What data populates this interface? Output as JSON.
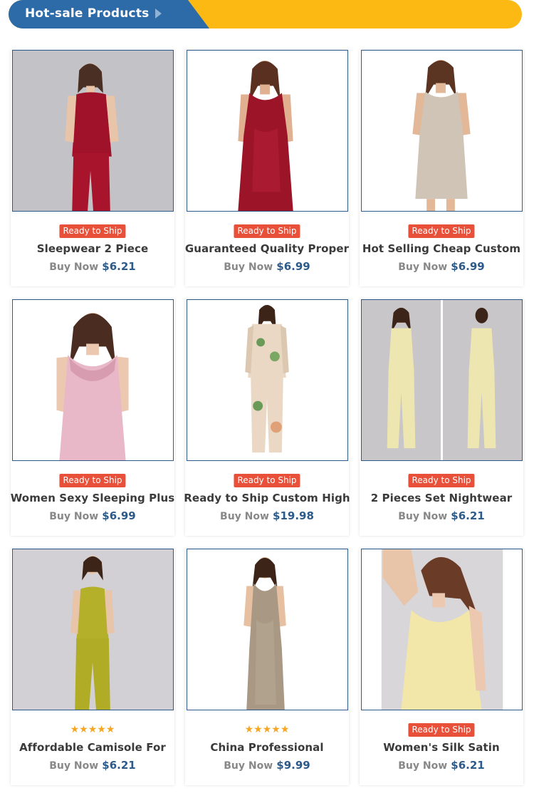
{
  "header": {
    "title": "Hot-sale Products"
  },
  "colors": {
    "banner_blue": "#2c6aa8",
    "banner_yellow": "#fdb913",
    "badge": "#e8503a",
    "price": "#2c5a8a"
  },
  "products": [
    {
      "title": "Sleepwear 2 Piece",
      "badge": "Ready to Ship",
      "buy_label": "Buy Now",
      "price": "$6.21",
      "image": "red-satin-pajama-set"
    },
    {
      "title": "Guaranteed Quality Proper",
      "badge": "Ready to Ship",
      "buy_label": "Buy Now",
      "price": "$6.99",
      "image": "red-satin-slip-dress"
    },
    {
      "title": "Hot Selling Cheap Custom",
      "badge": "Ready to Ship",
      "buy_label": "Buy Now",
      "price": "$6.99",
      "image": "champagne-satin-slip-dress"
    },
    {
      "title": "Women Sexy Sleeping Plus",
      "badge": "Ready to Ship",
      "buy_label": "Buy Now",
      "price": "$6.99",
      "image": "pink-satin-lace-nightgown"
    },
    {
      "title": "Ready to Ship Custom High",
      "badge": "Ready to Ship",
      "buy_label": "Buy Now",
      "price": "$19.98",
      "image": "floral-print-pajama-set"
    },
    {
      "title": "2 Pieces Set Nightwear",
      "badge": "Ready to Ship",
      "buy_label": "Buy Now",
      "price": "$6.21",
      "image": "cream-pajama-set-front-back"
    },
    {
      "title": "Affordable Camisole For",
      "rating": "★★★★★",
      "buy_label": "Buy Now",
      "price": "$6.21",
      "image": "olive-satin-pajama-set"
    },
    {
      "title": "China Professional",
      "rating": "★★★★★",
      "buy_label": "Buy Now",
      "price": "$9.99",
      "image": "taupe-satin-slip-dress"
    },
    {
      "title": "Women's Silk Satin",
      "badge": "Ready to Ship",
      "buy_label": "Buy Now",
      "price": "$6.21",
      "image": "cream-silk-camisole"
    }
  ]
}
